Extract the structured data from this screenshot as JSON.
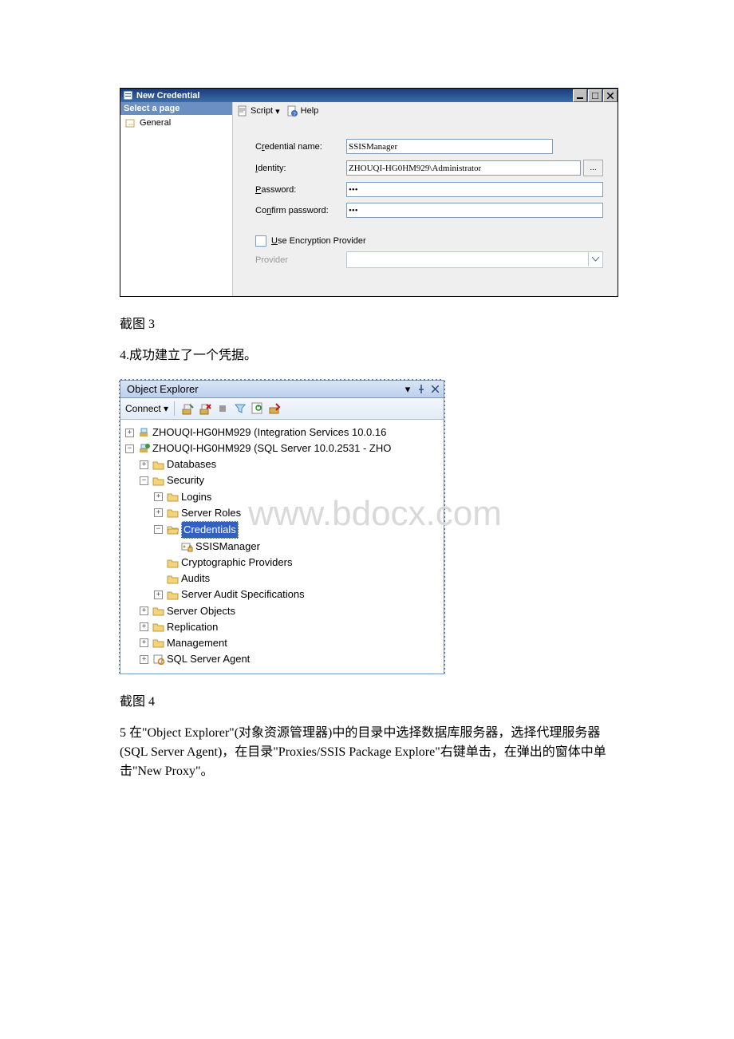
{
  "dialog": {
    "title": "New Credential",
    "sidepanel_header": "Select a page",
    "sidepanel_item": "General",
    "toolbar": {
      "script": "Script",
      "help": "Help"
    },
    "labels": {
      "cred_name_pre": "C",
      "cred_name_u": "r",
      "cred_name_post": "edential name:",
      "identity_pre": "",
      "identity_u": "I",
      "identity_post": "dentity:",
      "password_pre": "",
      "password_u": "P",
      "password_post": "assword:",
      "confirm_pre": "Co",
      "confirm_u": "n",
      "confirm_post": "firm password:",
      "useenc_pre": "",
      "useenc_u": "U",
      "useenc_post": "se Encryption Provider",
      "provider": "Provider"
    },
    "values": {
      "cred_name": "SSISManager",
      "identity": "ZHOUQI-HG0HM929\\Administrator",
      "password": "•••",
      "confirm": "•••",
      "browse": "..."
    }
  },
  "captions": {
    "c3": "截图 3",
    "c4": "截图 4"
  },
  "text": {
    "t4": "4.成功建立了一个凭据。",
    "t5": "5 在\"Object Explorer\"(对象资源管理器)中的目录中选择数据库服务器，选择代理服务器(SQL Server Agent)，在目录\"Proxies/SSIS Package Explore\"右键单击，在弹出的窗体中单击\"New Proxy\"。"
  },
  "oe": {
    "title": "Object Explorer",
    "connect": "Connect",
    "watermark": "www.bdocx.com",
    "nodes": {
      "is": "ZHOUQI-HG0HM929 (Integration Services 10.0.16",
      "sql": "ZHOUQI-HG0HM929 (SQL Server 10.0.2531 - ZHO",
      "db": "Databases",
      "sec": "Security",
      "logins": "Logins",
      "roles": "Server Roles",
      "creds": "Credentials",
      "ssism": "SSISManager",
      "crypt": "Cryptographic Providers",
      "audits": "Audits",
      "sas": "Server Audit Specifications",
      "sobj": "Server Objects",
      "repl": "Replication",
      "mgmt": "Management",
      "agent": "SQL Server Agent"
    }
  }
}
